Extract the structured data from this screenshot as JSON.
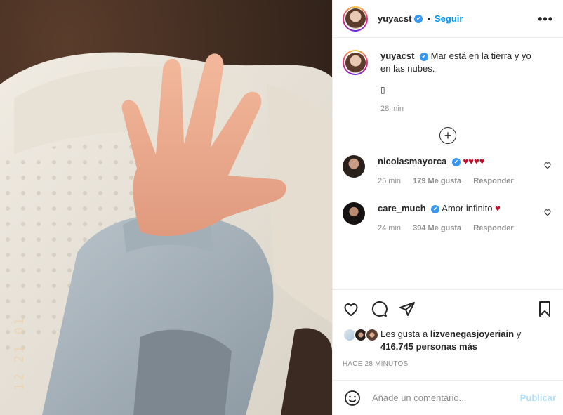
{
  "photo": {
    "alt": "photo-of-baby-hand",
    "date_stamp": "12 21 01"
  },
  "header": {
    "username": "yuyacst",
    "verified_glyph": "✔",
    "separator": "•",
    "follow_label": "Seguir",
    "more_glyph": "•••"
  },
  "caption": {
    "username": "yuyacst",
    "text": "Mar está en la tierra y yo en las nubes.",
    "emoji": "▯",
    "time": "28 min"
  },
  "load_more": {
    "glyph": "+"
  },
  "comments": [
    {
      "username": "nicolasmayorca",
      "text": "",
      "hearts": "♥♥♥♥",
      "time": "25 min",
      "likes": "179 Me gusta",
      "reply": "Responder",
      "avatar_color": "#3b2f2a"
    },
    {
      "username": "care_much",
      "text": "Amor infinito",
      "hearts": "♥",
      "time": "24 min",
      "likes": "394 Me gusta",
      "reply": "Responder",
      "avatar_color": "#1f1b1a"
    }
  ],
  "likes": {
    "prefix": "Les gusta a",
    "liker": "lizvenegasjoyeriain",
    "connector": "y",
    "others": "416.745 personas más"
  },
  "posted_ago": "HACE 28 MINUTOS",
  "comment_input": {
    "placeholder": "Añade un comentario...",
    "publish_label": "Publicar"
  },
  "icons": {
    "like": "heart-icon",
    "comment": "comment-icon",
    "share": "paper-plane-icon",
    "save": "bookmark-icon",
    "emoji": "smiley-icon",
    "load_more": "plus-circle-icon"
  },
  "colors": {
    "accent_blue": "#0095f6",
    "verified_blue": "#3897f0",
    "heart_red": "#c0102a",
    "muted": "#8e8e8e",
    "publish_disabled": "#b2dffc"
  }
}
